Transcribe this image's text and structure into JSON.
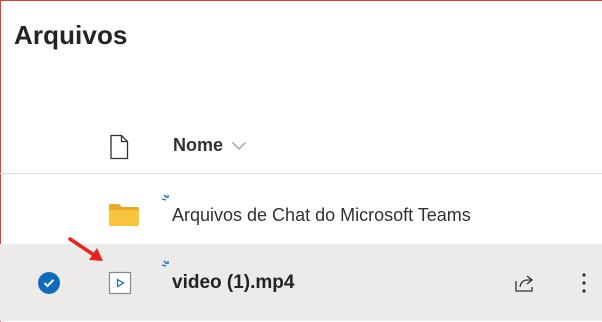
{
  "page": {
    "title": "Arquivos"
  },
  "columns": {
    "name_header": "Nome"
  },
  "rows": [
    {
      "type": "folder",
      "name": "Arquivos de Chat do Microsoft Teams",
      "icon": "folder-icon",
      "selected": false
    },
    {
      "type": "file",
      "name": "video (1).mp4",
      "icon": "video-file-icon",
      "selected": true
    }
  ],
  "colors": {
    "accent": "#0f6cbd",
    "folder": "#f8c43c",
    "selected_row": "#edebe9",
    "annotation_border": "#e8392f",
    "annotation_arrow": "#e8231c"
  }
}
